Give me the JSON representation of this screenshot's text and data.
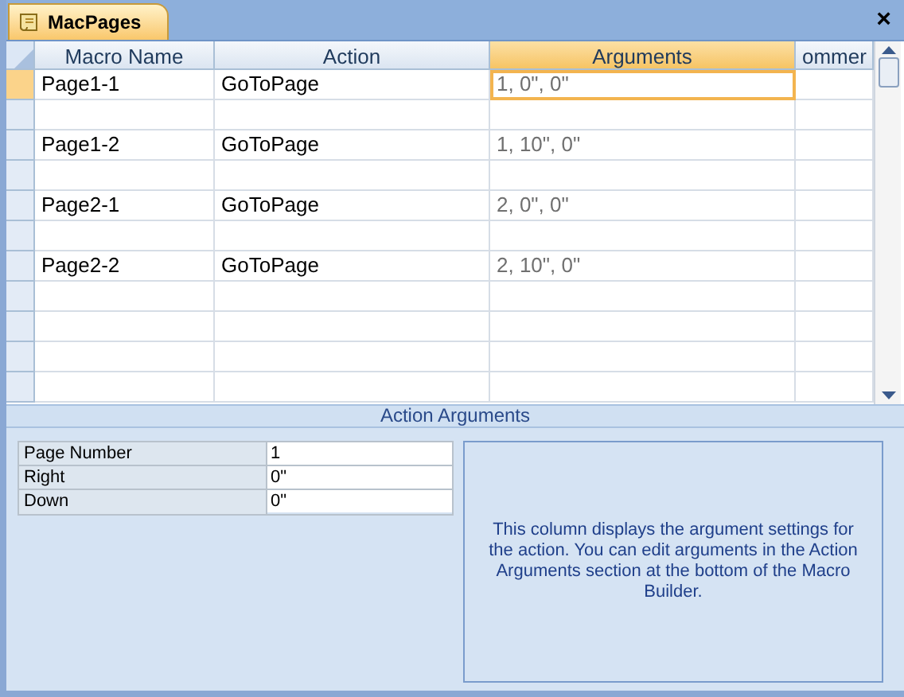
{
  "tab": {
    "title": "MacPages",
    "selected": true
  },
  "close": "×",
  "columns": [
    {
      "label": "Macro Name",
      "selected": false
    },
    {
      "label": "Action",
      "selected": false
    },
    {
      "label": "Arguments",
      "selected": true
    },
    {
      "label": "ommer",
      "selected": false
    }
  ],
  "rows": [
    {
      "kind": "macro",
      "name": "Page1-1",
      "action": "GoToPage",
      "arguments": "1, 0\", 0\"",
      "selected": true
    },
    {
      "kind": "blank",
      "selected": false
    },
    {
      "kind": "macro",
      "name": "Page1-2",
      "action": "GoToPage",
      "arguments": "1, 10\", 0\"",
      "selected": false
    },
    {
      "kind": "blank",
      "selected": false
    },
    {
      "kind": "macro",
      "name": "Page2-1",
      "action": "GoToPage",
      "arguments": "2, 0\", 0\"",
      "selected": false
    },
    {
      "kind": "blank",
      "selected": false
    },
    {
      "kind": "macro",
      "name": "Page2-2",
      "action": "GoToPage",
      "arguments": "2, 10\", 0\"",
      "selected": false
    },
    {
      "kind": "blank",
      "selected": false
    },
    {
      "kind": "blank",
      "selected": false
    },
    {
      "kind": "blank",
      "selected": false
    },
    {
      "kind": "blank",
      "selected": false
    }
  ],
  "action_arguments": {
    "title": "Action Arguments",
    "fields": [
      {
        "label": "Page Number",
        "value": "1"
      },
      {
        "label": "Right",
        "value": "0\""
      },
      {
        "label": "Down",
        "value": "0\""
      }
    ],
    "help": "This column displays the argument settings for the action. You can edit arguments in the Action Arguments section at the bottom of the Macro Builder."
  }
}
